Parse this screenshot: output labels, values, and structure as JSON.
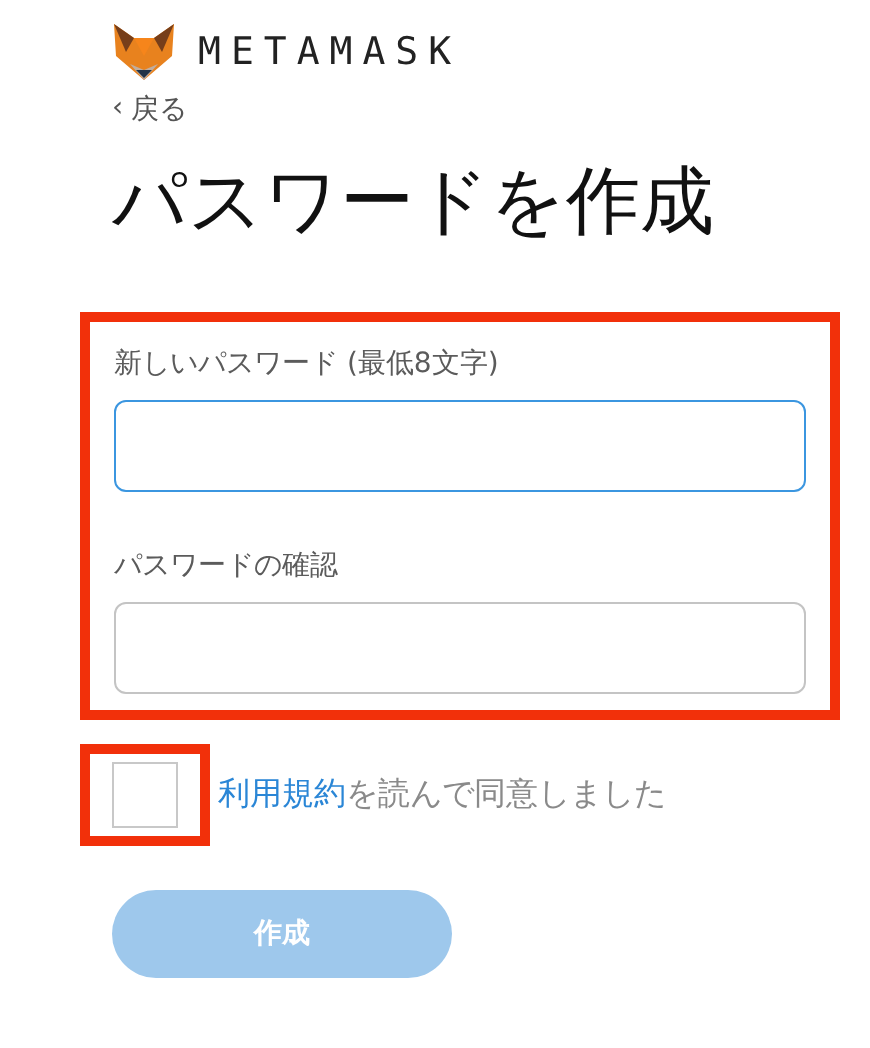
{
  "brand": {
    "name": "METAMASK"
  },
  "back": {
    "arrow": "‹",
    "label": "戻る"
  },
  "title": "パスワードを作成",
  "form": {
    "highlighted": true,
    "fields": [
      {
        "label": "新しいパスワード (最低8文字)",
        "focused": true
      },
      {
        "label": "パスワードの確認",
        "focused": false
      }
    ]
  },
  "terms": {
    "checked": false,
    "highlighted": true,
    "link": "利用規約",
    "text": "を読んで同意しました"
  },
  "submit": {
    "label": "作成",
    "disabled": true
  }
}
